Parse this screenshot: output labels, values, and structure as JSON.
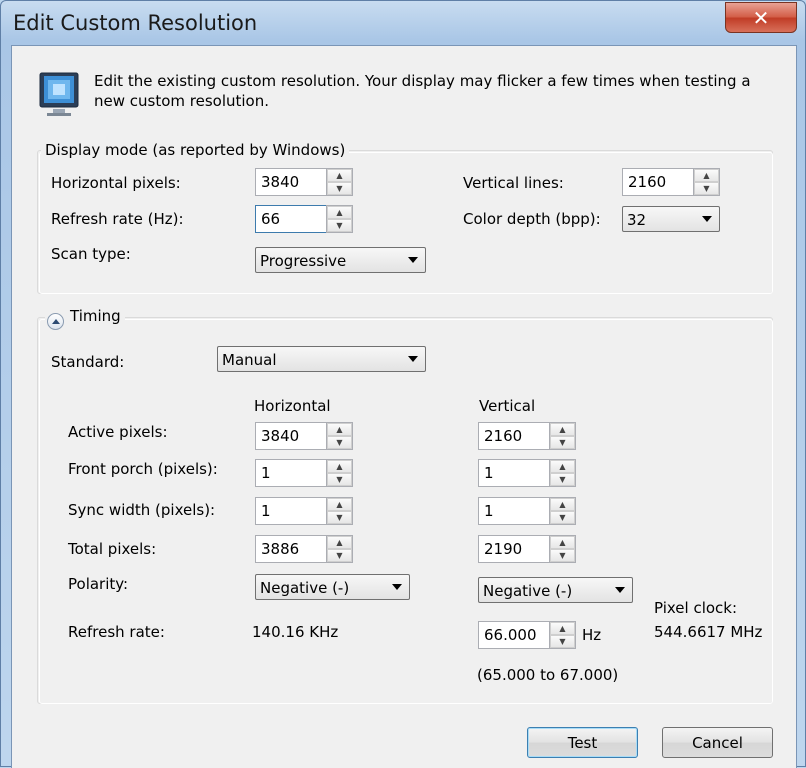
{
  "window": {
    "title": "Edit Custom Resolution",
    "close_glyph": "✕"
  },
  "intro": {
    "icon": "monitor-icon",
    "text": "Edit the existing custom resolution. Your display may flicker a few times when testing a new custom resolution."
  },
  "display_mode": {
    "legend": "Display mode (as reported by Windows)",
    "horizontal_pixels_label": "Horizontal pixels:",
    "horizontal_pixels_value": "3840",
    "vertical_lines_label": "Vertical lines:",
    "vertical_lines_value": "2160",
    "refresh_rate_label": "Refresh rate (Hz):",
    "refresh_rate_value": "66",
    "color_depth_label": "Color depth (bpp):",
    "color_depth_value": "32",
    "scan_type_label": "Scan type:",
    "scan_type_value": "Progressive"
  },
  "timing": {
    "legend": "Timing",
    "standard_label": "Standard:",
    "standard_value": "Manual",
    "col_horizontal": "Horizontal",
    "col_vertical": "Vertical",
    "rows": [
      {
        "label": "Active pixels:",
        "h": "3840",
        "v": "2160"
      },
      {
        "label": "Front porch (pixels):",
        "h": "1",
        "v": "1"
      },
      {
        "label": "Sync width (pixels):",
        "h": "1",
        "v": "1"
      },
      {
        "label": "Total pixels:",
        "h": "3886",
        "v": "2190"
      }
    ],
    "polarity_label": "Polarity:",
    "polarity_h": "Negative (-)",
    "polarity_v": "Negative (-)",
    "refresh_rate_label": "Refresh rate:",
    "refresh_rate_h": "140.16 KHz",
    "refresh_rate_v": "66.000",
    "refresh_rate_unit": "Hz",
    "refresh_range": "(65.000 to 67.000)",
    "pixel_clock_label": "Pixel clock:",
    "pixel_clock_value": "544.6617 MHz"
  },
  "buttons": {
    "test": "Test",
    "cancel": "Cancel"
  },
  "colors": {
    "title_bar": "#bcd6ee",
    "client_bg": "#f0f0f0",
    "close_button": "#c84a33"
  }
}
